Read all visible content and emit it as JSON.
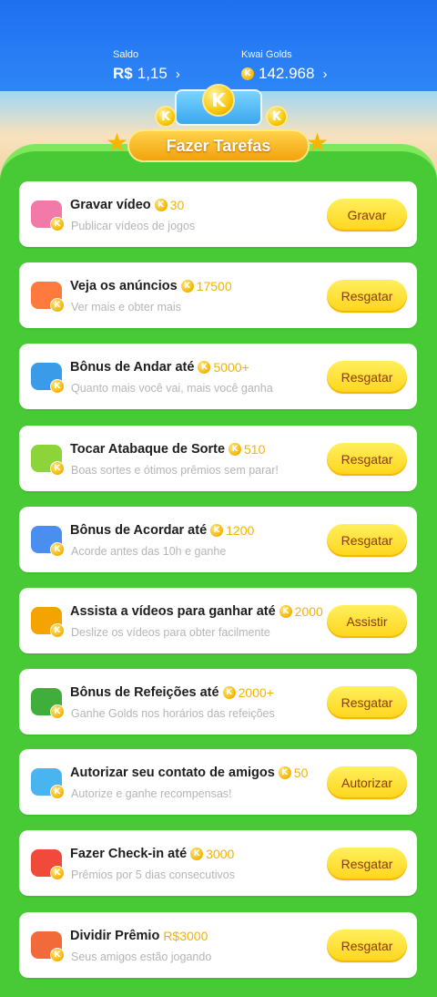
{
  "header": {
    "saldo_label": "Saldo",
    "saldo_currency": "R$",
    "saldo_value": "1,15",
    "golds_label": "Kwai Golds",
    "golds_value": "142.968"
  },
  "banner": {
    "title": "Fazer Tarefas",
    "coin_letter": "K"
  },
  "tasks": [
    {
      "title": "Gravar vídeo",
      "reward": "30",
      "subtitle": "Publicar vídeos de jogos",
      "button": "Gravar",
      "icon": "video-record-icon",
      "color": "#f27aa8"
    },
    {
      "title": "Veja os anúncios",
      "reward": "17500",
      "subtitle": "Ver mais e obter mais",
      "button": "Resgatar",
      "icon": "tv-ads-icon",
      "color": "#ff7a3c"
    },
    {
      "title": "Bônus de Andar até",
      "reward": "5000+",
      "subtitle": "Quanto mais você vai, mais você ganha",
      "button": "Resgatar",
      "icon": "walking-boy-icon",
      "color": "#3a9be8"
    },
    {
      "title": "Tocar Atabaque de Sorte",
      "reward": "510",
      "subtitle": "Boas sortes e ótimos prêmios sem parar!",
      "button": "Resgatar",
      "icon": "drum-icon",
      "color": "#8dd43a"
    },
    {
      "title": "Bônus de Acordar até",
      "reward": "1200",
      "subtitle": "Acorde antes das 10h e ganhe",
      "button": "Resgatar",
      "icon": "alarm-icon",
      "color": "#4a8ef0"
    },
    {
      "title": "Assista a vídeos para ganhar até",
      "reward": "2000",
      "subtitle": "Deslize os vídeos para obter facilmente",
      "button": "Assistir",
      "icon": "camera-icon",
      "color": "#f5a300"
    },
    {
      "title": "Bônus de Refeições até",
      "reward": "2000+",
      "subtitle": "Ganhe Golds nos horários das refeições",
      "button": "Resgatar",
      "icon": "meal-bag-icon",
      "color": "#3fae3a"
    },
    {
      "title": "Autorizar seu contato de amigos",
      "reward": "50",
      "subtitle": "Autorize e ganhe recompensas!",
      "button": "Autorizar",
      "icon": "pointing-hand-icon",
      "color": "#4ab4f0"
    },
    {
      "title": "Fazer Check-in até",
      "reward": "3000",
      "subtitle": "Prêmios por 5 dias consecutivos",
      "button": "Resgatar",
      "icon": "calendar-icon",
      "color": "#f24a3a"
    },
    {
      "title": "Dividir Prêmio",
      "reward": "R$3000",
      "reward_is_cash": true,
      "subtitle": "Seus amigos estão jogando",
      "button": "Resgatar",
      "icon": "gift-box-icon",
      "color": "#f26a3a"
    }
  ]
}
